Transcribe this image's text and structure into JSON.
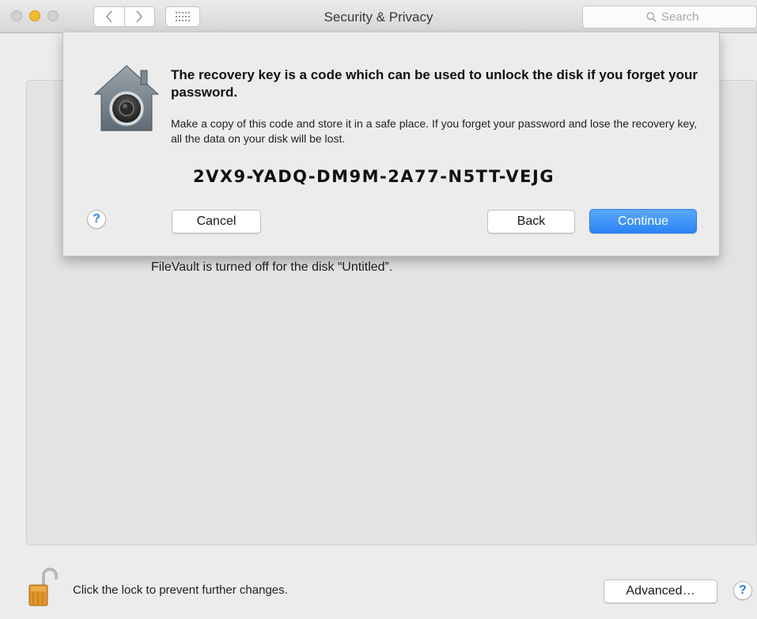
{
  "window": {
    "title": "Security & Privacy",
    "search_placeholder": "Search"
  },
  "sheet": {
    "heading": "The recovery key is a code which can be used to unlock the disk if you forget your password.",
    "body": "Make a copy of this code and store it in a safe place.  If you forget your password and lose the recovery key, all the data on your disk will be lost.",
    "recovery_key": "2VX9-YADQ-DM9M-2A77-N5TT-VEJG",
    "help_label": "?",
    "cancel_label": "Cancel",
    "back_label": "Back",
    "continue_label": "Continue"
  },
  "main": {
    "filevault_status": "FileVault is turned off for the disk “Untitled”."
  },
  "footer": {
    "lock_text": "Click the lock to prevent further changes.",
    "advanced_label": "Advanced…",
    "help_label": "?"
  },
  "colors": {
    "accent": "#2b83f4",
    "window_bg": "#ececec",
    "minimize": "#f5b82e"
  }
}
